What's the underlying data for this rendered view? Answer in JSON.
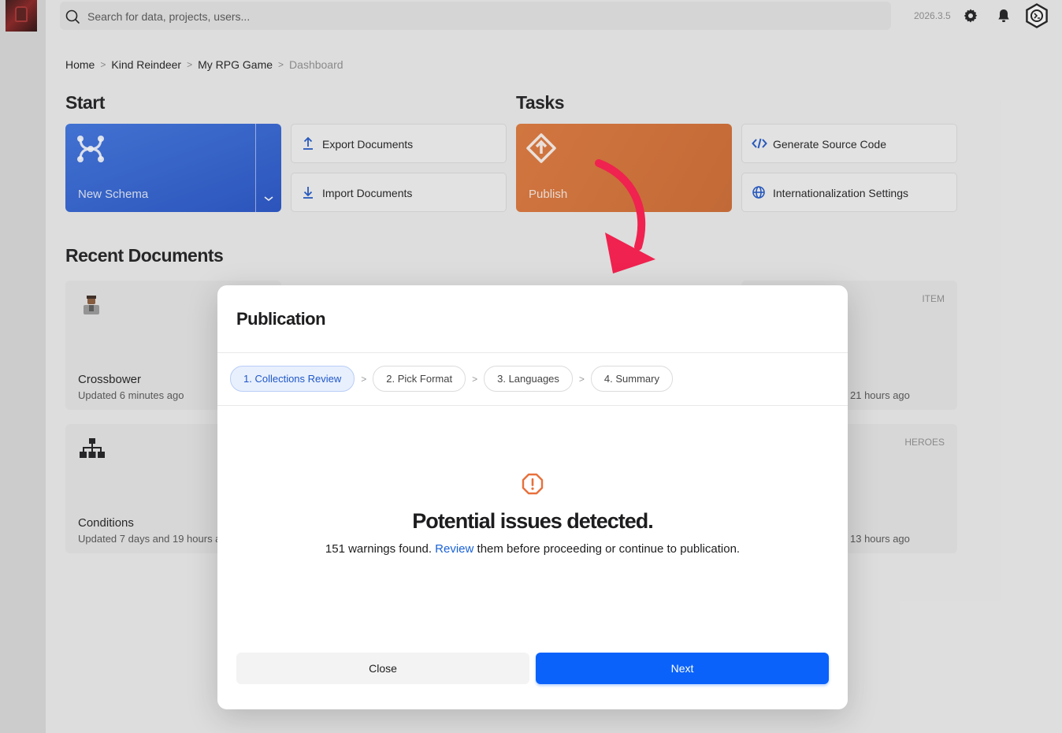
{
  "topbar": {
    "search_placeholder": "Search for data, projects, users...",
    "version": "2026.3.5",
    "icons": [
      "search-icon",
      "gear-icon",
      "bell-icon",
      "logo-icon"
    ]
  },
  "breadcrumbs": {
    "items": [
      "Home",
      "Kind Reindeer",
      "My RPG Game"
    ],
    "current": "Dashboard"
  },
  "start": {
    "heading": "Start",
    "new_schema_label": "New Schema",
    "export_label": "Export Documents",
    "import_label": "Import Documents"
  },
  "tasks": {
    "heading": "Tasks",
    "publish_label": "Publish",
    "generate_label": "Generate Source Code",
    "i18n_label": "Internationalization Settings"
  },
  "recent": {
    "heading": "Recent Documents",
    "docs": [
      {
        "title": "Crossbower",
        "updated": "Updated 6 minutes ago"
      },
      {
        "title": "Conditions",
        "updated": "Updated 7 days and 19 hours a"
      }
    ],
    "right_docs": [
      {
        "tag": "ITEM",
        "updated": "21 hours ago"
      },
      {
        "tag": "HEROES",
        "updated": "13 hours ago"
      }
    ]
  },
  "modal": {
    "title": "Publication",
    "steps": [
      "1. Collections Review",
      "2. Pick Format",
      "3. Languages",
      "4. Summary"
    ],
    "headline": "Potential issues detected.",
    "desc_before": "151 warnings found. ",
    "desc_link": "Review",
    "desc_after": " them before proceeding or continue to publication.",
    "close_label": "Close",
    "next_label": "Next"
  },
  "colors": {
    "primary_blue": "#2452c7",
    "publish_orange": "#d46f32",
    "next_button": "#0a62fb",
    "warning": "#e8703a",
    "arrow": "#f0224f"
  }
}
